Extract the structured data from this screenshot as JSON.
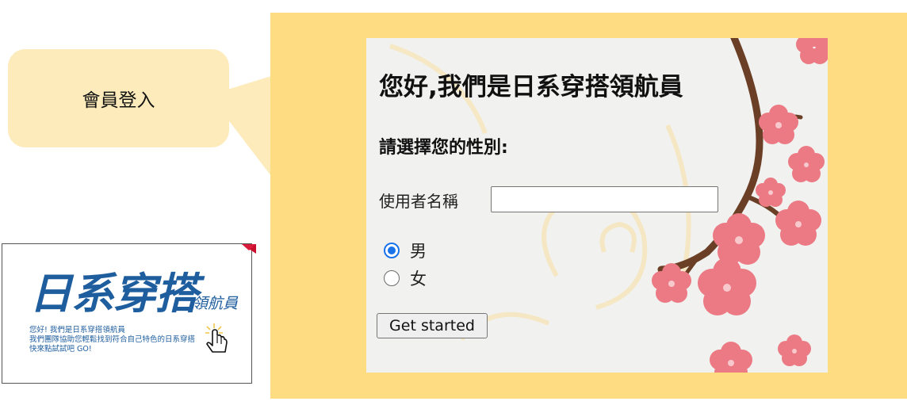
{
  "callout": {
    "label": "會員登入"
  },
  "thumbnail": {
    "title": "日系穿搭",
    "subtitle": "領航員",
    "lines": [
      "您好! 我們是日系穿搭領航員",
      "我們團隊協助您輕鬆找到符合自己特色的日系穿搭",
      "快來點試試吧 GO!"
    ],
    "icon": "pointer-click-icon"
  },
  "form": {
    "heading": "您好,我們是日系穿搭領航員",
    "gender_prompt": "請選擇您的性別:",
    "username_label": "使用者名稱",
    "username_value": "",
    "gender_options": [
      {
        "label": "男",
        "checked": true
      },
      {
        "label": "女",
        "checked": false
      }
    ],
    "submit_label": "Get started"
  },
  "colors": {
    "panel": "#fedc82",
    "bubble": "#fdebbc",
    "brand_blue": "#1e5d9e",
    "blossom": "#ec7a84",
    "branch": "#6b3f26",
    "radio_accent": "#1a73e8"
  }
}
